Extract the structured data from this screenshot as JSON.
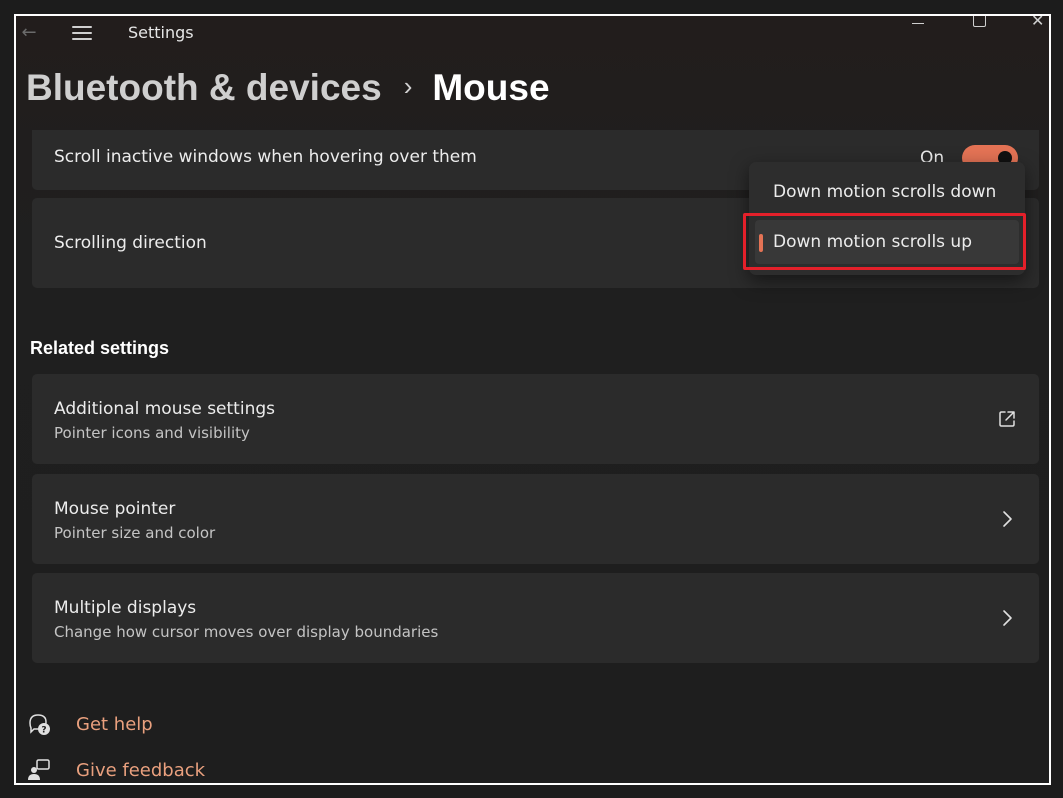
{
  "window": {
    "app_title": "Settings",
    "back_icon": "back-arrow-icon",
    "menu_icon": "hamburger-icon"
  },
  "breadcrumb": {
    "parent": "Bluetooth & devices",
    "separator": "›",
    "current": "Mouse"
  },
  "scroll_inactive": {
    "title": "Scroll inactive windows when hovering over them",
    "toggle_label": "On",
    "toggle_on": true
  },
  "scrolling_direction": {
    "title": "Scrolling direction",
    "options": [
      "Down motion scrolls down",
      "Down motion scrolls up"
    ],
    "selected": "Down motion scrolls up"
  },
  "related": {
    "heading": "Related settings",
    "items": [
      {
        "title": "Additional mouse settings",
        "subtitle": "Pointer icons and visibility",
        "icon": "open-external-icon"
      },
      {
        "title": "Mouse pointer",
        "subtitle": "Pointer size and color",
        "icon": "chevron-right-icon"
      },
      {
        "title": "Multiple displays",
        "subtitle": "Change how cursor moves over display boundaries",
        "icon": "chevron-right-icon"
      }
    ]
  },
  "footer": {
    "help": "Get help",
    "feedback": "Give feedback"
  },
  "colors": {
    "accent": "#e47355",
    "highlight": "#e4202a",
    "link": "#e9a07e"
  }
}
